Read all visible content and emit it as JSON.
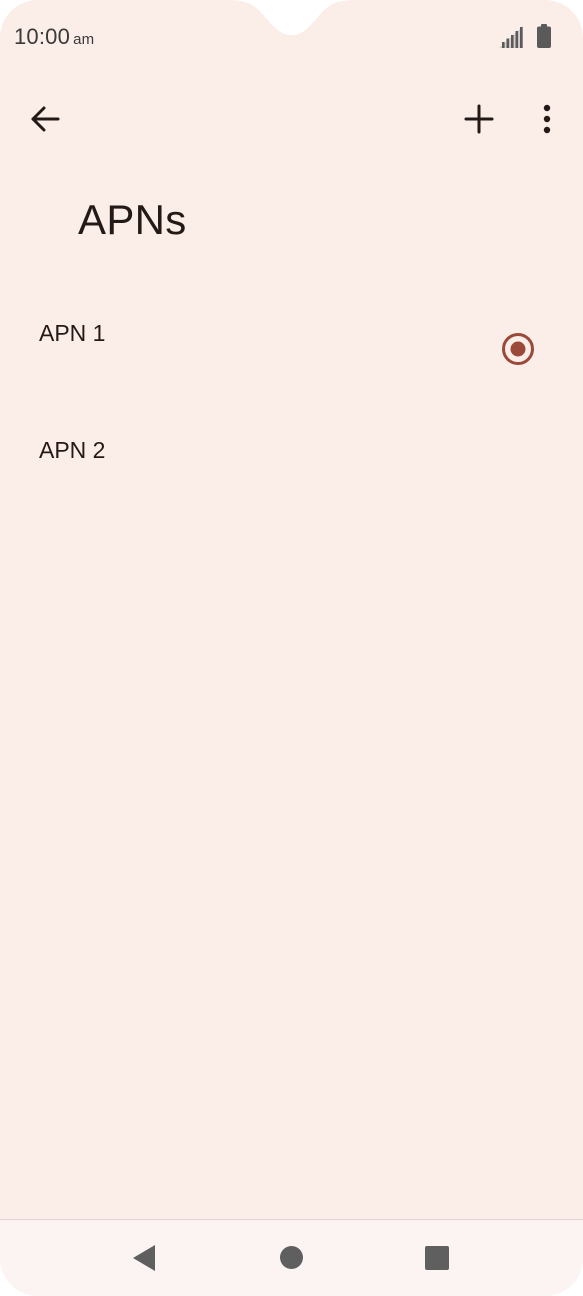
{
  "status_bar": {
    "time": "10:00",
    "ampm": "am",
    "signal_icon": "cell-signal-icon",
    "battery_icon": "battery-icon"
  },
  "toolbar": {
    "back_icon": "arrow-back-icon",
    "add_icon": "plus-icon",
    "more_icon": "more-vert-icon"
  },
  "page": {
    "title": "APNs"
  },
  "apns": [
    {
      "label": "APN 1",
      "selected": true
    },
    {
      "label": "APN 2",
      "selected": false
    }
  ],
  "nav_bar": {
    "back_icon": "nav-back-icon",
    "home_icon": "nav-home-icon",
    "recents_icon": "nav-recents-icon"
  },
  "colors": {
    "background": "#fbede8",
    "text": "#231a18",
    "accent": "#9b4a3a",
    "nav_background": "#fbf4f3"
  }
}
